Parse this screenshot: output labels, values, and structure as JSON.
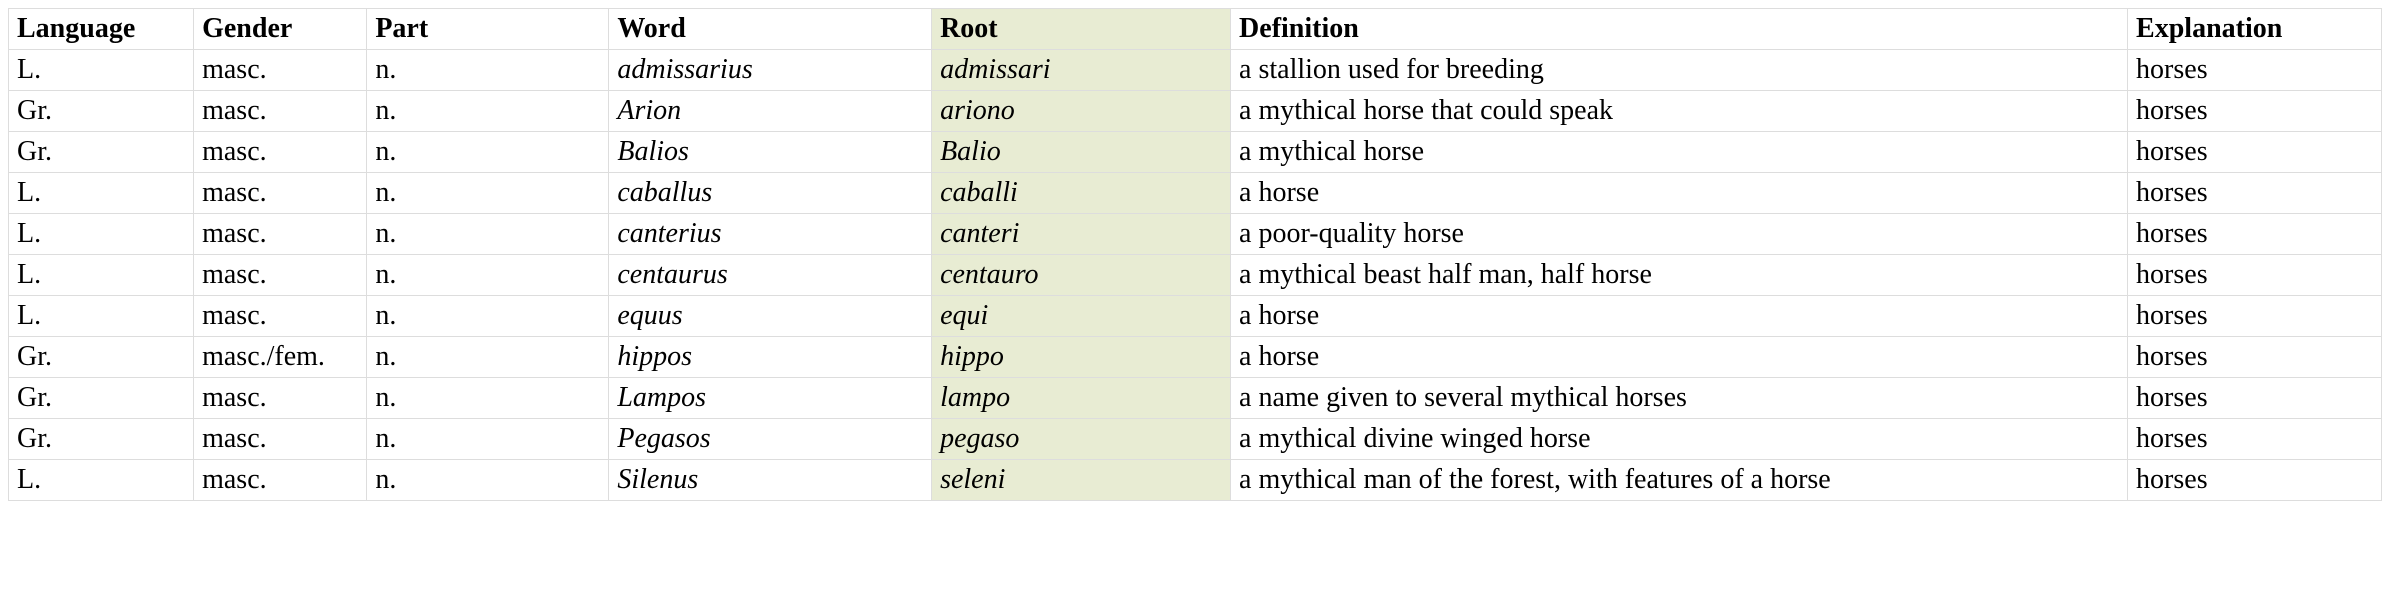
{
  "table": {
    "highlight_col": 4,
    "italic_cols": [
      3,
      4
    ],
    "headers": [
      "Language",
      "Gender",
      "Part",
      "Word",
      "Root",
      "Definition",
      "Explanation"
    ],
    "rows": [
      [
        "L.",
        "masc.",
        "n.",
        "admissarius",
        "admissari",
        "a stallion used for breeding",
        "horses"
      ],
      [
        "Gr.",
        "masc.",
        "n.",
        "Arion",
        "ariono",
        "a mythical horse that could speak",
        "horses"
      ],
      [
        "Gr.",
        "masc.",
        "n.",
        "Balios",
        "Balio",
        "a mythical horse",
        "horses"
      ],
      [
        "L.",
        "masc.",
        "n.",
        "caballus",
        "caballi",
        "a horse",
        "horses"
      ],
      [
        "L.",
        "masc.",
        "n.",
        "canterius",
        "canteri",
        "a poor-quality horse",
        "horses"
      ],
      [
        "L.",
        "masc.",
        "n.",
        "centaurus",
        "centauro",
        "a mythical beast half man, half horse",
        "horses"
      ],
      [
        "L.",
        "masc.",
        "n.",
        "equus",
        "equi",
        "a horse",
        "horses"
      ],
      [
        "Gr.",
        "masc./fem.",
        "n.",
        "hippos",
        "hippo",
        "a horse",
        "horses"
      ],
      [
        "Gr.",
        "masc.",
        "n.",
        "Lampos",
        "lampo",
        "a name given to several mythical horses",
        "horses"
      ],
      [
        "Gr.",
        "masc.",
        "n.",
        "Pegasos",
        "pegaso",
        "a mythical divine winged horse",
        "horses"
      ],
      [
        "L.",
        "masc.",
        "n.",
        "Silenus",
        "seleni",
        "a mythical man of the forest, with features of a horse",
        "horses"
      ]
    ]
  }
}
